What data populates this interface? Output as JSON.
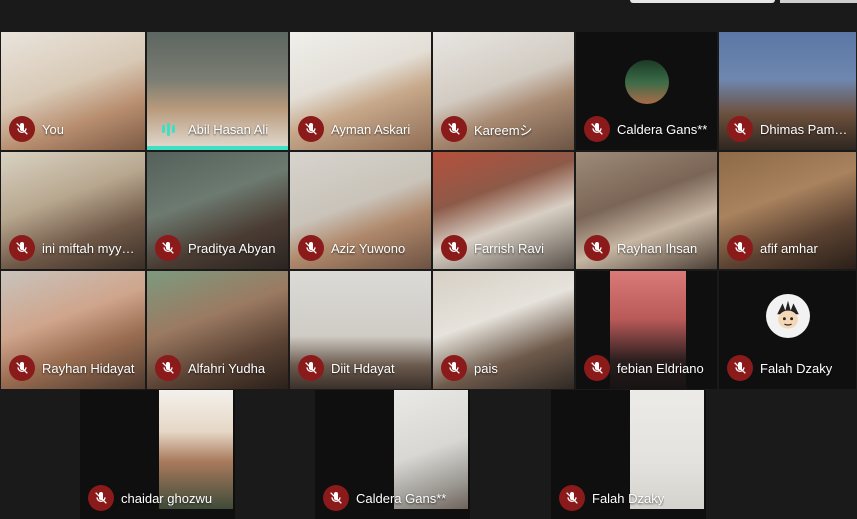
{
  "meeting": {
    "participants": [
      {
        "name": "You",
        "muted": true
      },
      {
        "name": "Abil Hasan Ali",
        "muted": false,
        "speaking": true
      },
      {
        "name": "Ayman Askari",
        "muted": true
      },
      {
        "name": "Kareemシ",
        "muted": true
      },
      {
        "name": "Caldera Gans**",
        "muted": true
      },
      {
        "name": "Dhimas Pamu…",
        "muted": true
      },
      {
        "name": "ini miftah myy…",
        "muted": true
      },
      {
        "name": "Praditya Abyan",
        "muted": true
      },
      {
        "name": "Aziz Yuwono",
        "muted": true
      },
      {
        "name": "Farrish Ravi",
        "muted": true
      },
      {
        "name": "Rayhan Ihsan",
        "muted": true
      },
      {
        "name": "afif amhar",
        "muted": true
      },
      {
        "name": "Rayhan Hidayat",
        "muted": true
      },
      {
        "name": "Alfahri Yudha",
        "muted": true
      },
      {
        "name": "Diit Hdayat",
        "muted": true
      },
      {
        "name": "pais",
        "muted": true
      },
      {
        "name": "febian Eldriano",
        "muted": true
      },
      {
        "name": "Falah Dzaky",
        "muted": true
      },
      {
        "name": "chaidar ghozwu",
        "muted": true
      },
      {
        "name": "Caldera Gans**",
        "muted": true
      },
      {
        "name": "Falah Dzaky",
        "muted": true
      }
    ]
  },
  "colors": {
    "mic_muted_bg": "#8b1a1a",
    "speaking_accent": "#3ee0c3",
    "background": "#1a1a1a"
  },
  "icons": {
    "muted": "mic-off-icon",
    "speaking": "audio-level-icon",
    "avatar": "cartoon-avatar-icon"
  }
}
